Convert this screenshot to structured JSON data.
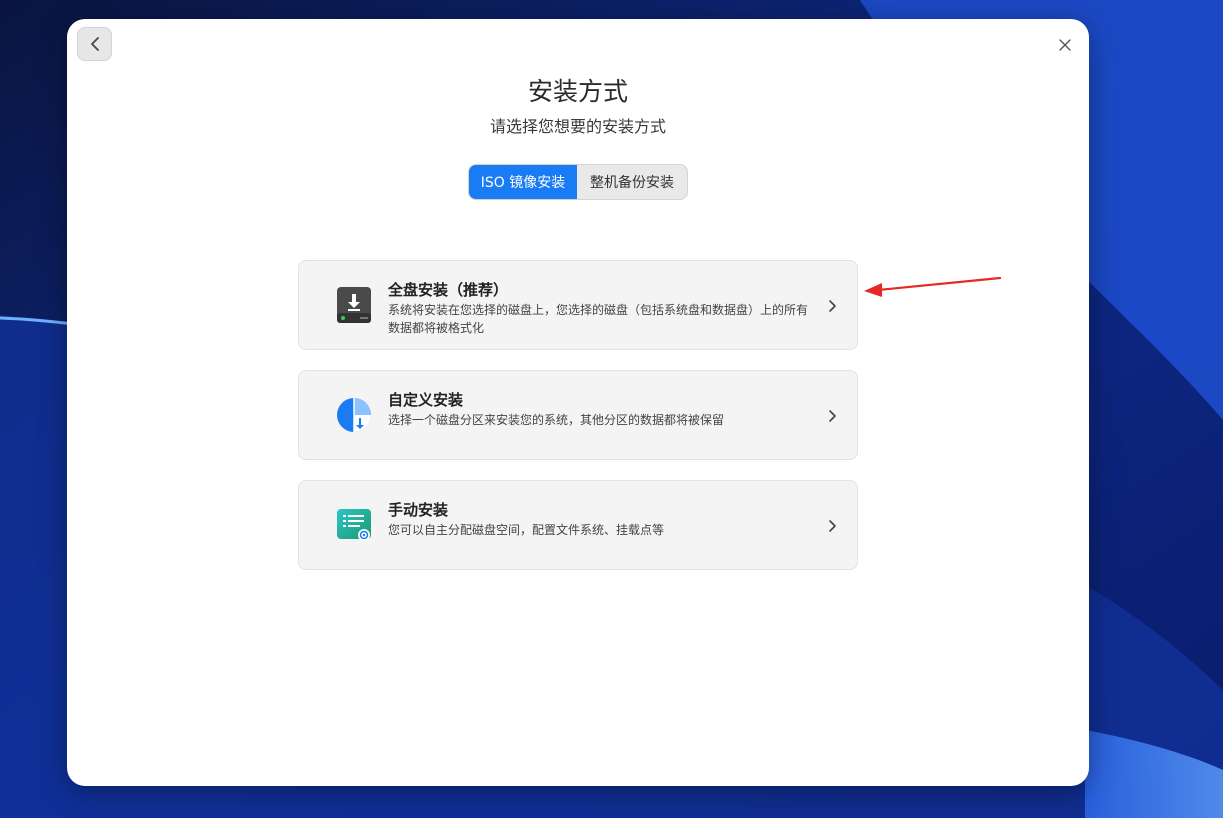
{
  "window": {
    "title": "安装方式",
    "subtitle": "请选择您想要的安装方式"
  },
  "mode_switch": {
    "options": [
      {
        "label": "ISO 镜像安装",
        "active": true
      },
      {
        "label": "整机备份安装",
        "active": false
      }
    ]
  },
  "install_options": [
    {
      "title": "全盘安装（推荐）",
      "description": "系统将安装在您选择的磁盘上，您选择的磁盘（包括系统盘和数据盘）上的所有数据都将被格式化",
      "icon": "disk-download-icon"
    },
    {
      "title": "自定义安装",
      "description": "选择一个磁盘分区来安装您的系统，其他分区的数据都将被保留",
      "icon": "partition-pie-icon"
    },
    {
      "title": "手动安装",
      "description": "您可以自主分配磁盘空间，配置文件系统、挂载点等",
      "icon": "manual-config-icon"
    }
  ],
  "colors": {
    "accent": "#1a7cf5",
    "annotation_arrow": "#e82727"
  }
}
